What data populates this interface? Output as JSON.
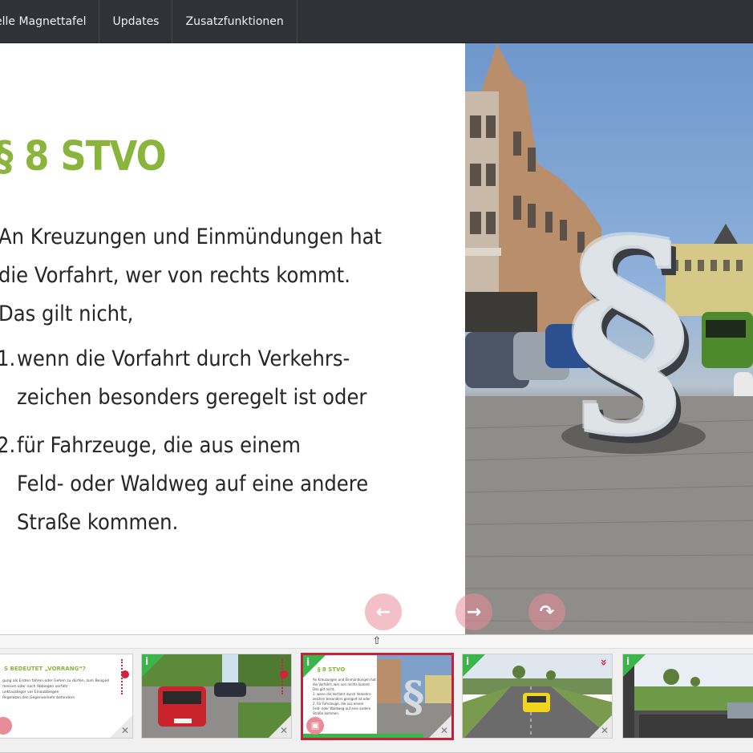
{
  "topnav": {
    "items": [
      "elle Magnettafel",
      "Updates",
      "Zusatzfunktionen"
    ]
  },
  "slide": {
    "title": "§ 8 STVO",
    "para_lines": [
      "An Kreuzungen und Einmündungen hat",
      "die Vorfahrt, wer von rechts kommt.",
      "Das gilt nicht,"
    ],
    "list": [
      {
        "num": "1.",
        "lines": [
          "wenn die Vorfahrt durch Verkehrs-",
          "zeichen besonders geregelt ist oder"
        ]
      },
      {
        "num": "2.",
        "lines": [
          "für Fahrzeuge, die aus einem",
          "Feld- oder Waldweg auf eine andere",
          "Straße kommen."
        ]
      }
    ]
  },
  "controls": {
    "prev_icon": "←",
    "next_icon": "→",
    "forward_icon": "↷",
    "strip_toggle_icon": "⇧"
  },
  "colors": {
    "accent_green": "#8ab43c",
    "badge_green": "#39b54a",
    "active_red": "#c0223a",
    "nav_dark": "#2f3237"
  },
  "thumbs": [
    {
      "title": "S BEDEUTET „VORRANG“?",
      "info": "i",
      "close": "✕",
      "lines": [
        "gung als Ersten fahren oder Gehen zu dürfen, zum Beispiel",
        "messen oder nach Abbiegen vorfahr",
        "unktausbiger vor Einaubbiegen",
        "Regelatan den Gegenverkehr behindern"
      ]
    },
    {
      "info": "i",
      "close": "✕"
    },
    {
      "title": "§ 8 STVO",
      "info": "i",
      "close": "✕",
      "lines": [
        "An Kreuzungen und Einmündungen hat",
        "die Vorfahrt, wer von rechts kommt.",
        "Das gilt nicht,",
        "1. wenn die Vorfahrt durch Verkehrs-",
        "   zeichen besonders geregelt ist oder",
        "2. für Fahrzeuge, die aus einem",
        "   Feld- oder Waldweg auf eine andere",
        "   Straße kommen."
      ]
    },
    {
      "info": "i",
      "close": "✕",
      "double_chevron": "»"
    },
    {
      "info": "i"
    }
  ]
}
